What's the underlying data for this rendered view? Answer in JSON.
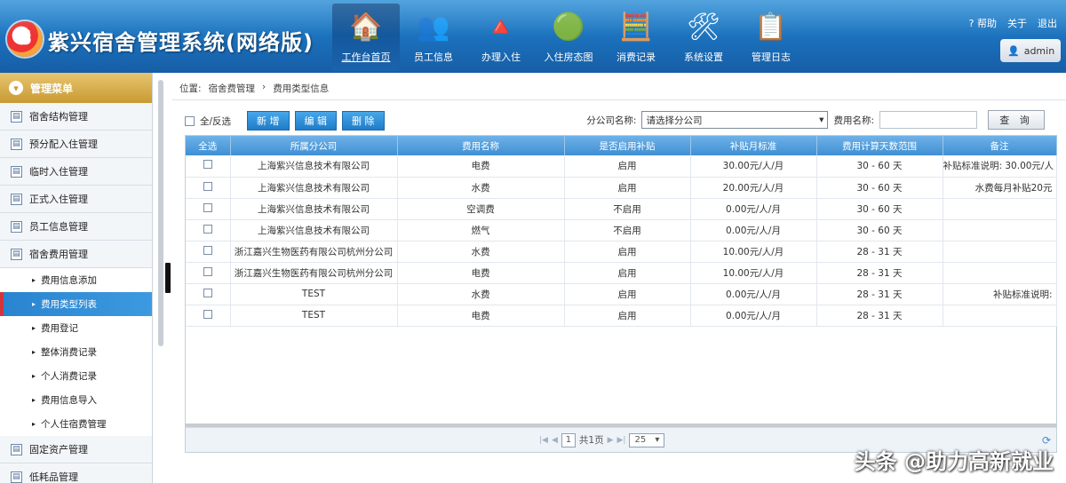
{
  "header": {
    "title": "紫兴宿舍管理系统(网络版)",
    "logo_letter": "S",
    "nav": [
      {
        "label": "工作台首页",
        "icon": "home-icon",
        "glyph": "🏠",
        "active": true
      },
      {
        "label": "员工信息",
        "icon": "people-icon",
        "glyph": "👥",
        "active": false
      },
      {
        "label": "办理入住",
        "icon": "checkin-icon",
        "glyph": "🔺",
        "active": false
      },
      {
        "label": "入住房态图",
        "icon": "room-status-icon",
        "glyph": "🟢",
        "active": false
      },
      {
        "label": "消费记录",
        "icon": "calculator-icon",
        "glyph": "🧮",
        "active": false
      },
      {
        "label": "系统设置",
        "icon": "tools-icon",
        "glyph": "🛠",
        "active": false
      },
      {
        "label": "管理日志",
        "icon": "log-icon",
        "glyph": "📋",
        "active": false
      }
    ],
    "links": {
      "help": "帮助",
      "about": "关于",
      "logout": "退出"
    },
    "user": "admin"
  },
  "sidebar": {
    "head": "管理菜单",
    "items_top": [
      {
        "label": "宿舍结构管理"
      },
      {
        "label": "预分配入住管理"
      },
      {
        "label": "临时入住管理"
      },
      {
        "label": "正式入住管理"
      },
      {
        "label": "员工信息管理"
      },
      {
        "label": "宿舍费用管理"
      }
    ],
    "sub_items": [
      {
        "label": "费用信息添加",
        "active": false
      },
      {
        "label": "费用类型列表",
        "active": true
      },
      {
        "label": "费用登记",
        "active": false
      },
      {
        "label": "整体消费记录",
        "active": false
      },
      {
        "label": "个人消费记录",
        "active": false
      },
      {
        "label": "费用信息导入",
        "active": false
      },
      {
        "label": "个人住宿费管理",
        "active": false
      }
    ],
    "items_bottom": [
      {
        "label": "固定资产管理"
      },
      {
        "label": "低耗品管理"
      }
    ]
  },
  "main": {
    "breadcrumb": [
      "位置:",
      "宿舍费管理",
      "›",
      "费用类型信息"
    ],
    "toolbar": {
      "select_all_label": "全/反选",
      "buttons": [
        "新 增",
        "编 辑",
        "删 除"
      ],
      "company_label": "分公司名称:",
      "company_value": "请选择分公司",
      "fee_name_label": "费用名称:",
      "fee_name_value": "",
      "query_label": "查 询"
    },
    "columns": [
      "全选",
      "所属分公司",
      "费用名称",
      "是否启用补贴",
      "补贴月标准",
      "费用计算天数范围",
      "备注"
    ],
    "rows": [
      [
        "上海紫兴信息技术有限公司",
        "电费",
        "启用",
        "30.00元/人/月",
        "30 - 60 天",
        "补贴标准说明: 30.00元/人"
      ],
      [
        "上海紫兴信息技术有限公司",
        "水费",
        "启用",
        "20.00元/人/月",
        "30 - 60 天",
        "水费每月补贴20元"
      ],
      [
        "上海紫兴信息技术有限公司",
        "空调费",
        "不启用",
        "0.00元/人/月",
        "30 - 60 天",
        ""
      ],
      [
        "上海紫兴信息技术有限公司",
        "燃气",
        "不启用",
        "0.00元/人/月",
        "30 - 60 天",
        ""
      ],
      [
        "浙江嘉兴生物医药有限公司杭州分公司",
        "水费",
        "启用",
        "10.00元/人/月",
        "28 - 31 天",
        ""
      ],
      [
        "浙江嘉兴生物医药有限公司杭州分公司",
        "电费",
        "启用",
        "10.00元/人/月",
        "28 - 31 天",
        ""
      ],
      [
        "TEST",
        "水费",
        "启用",
        "0.00元/人/月",
        "28 - 31 天",
        "补贴标准说明:"
      ],
      [
        "TEST",
        "电费",
        "启用",
        "0.00元/人/月",
        "28 - 31 天",
        ""
      ]
    ],
    "pager": {
      "page": "1",
      "total_pages": "共1页",
      "page_size": "25"
    }
  },
  "watermark": "头条 @助力高新就业"
}
